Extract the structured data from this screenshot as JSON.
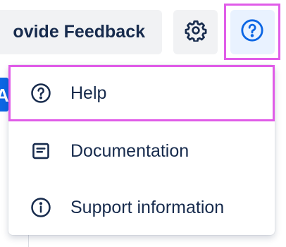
{
  "header": {
    "feedback_label": "ovide Feedback",
    "settings_icon": "gear-icon",
    "help_icon": "question-circle-icon",
    "left_button_fragment": "A"
  },
  "help_menu": {
    "items": [
      {
        "label": "Help",
        "icon": "question-circle-icon"
      },
      {
        "label": "Documentation",
        "icon": "document-icon"
      },
      {
        "label": "Support information",
        "icon": "info-circle-icon"
      }
    ]
  },
  "colors": {
    "text": "#172b4d",
    "button_bg": "#f1f2f4",
    "active_bg": "#e9f2ff",
    "accent": "#0c66e4",
    "highlight": "#e05ce8"
  }
}
